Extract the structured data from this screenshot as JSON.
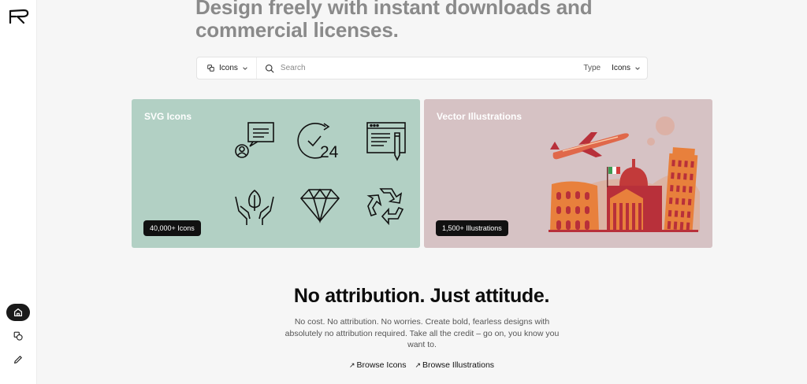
{
  "hero": {
    "title_line1": "Design freely with instant downloads and",
    "title_line2": "commercial licenses."
  },
  "search": {
    "category_label": "Icons",
    "placeholder": "Search",
    "type_label": "Type",
    "type_value": "Icons"
  },
  "cards": {
    "icons": {
      "title": "SVG Icons",
      "badge": "40,000+ Icons",
      "bg": "#b2d0c4"
    },
    "illustrations": {
      "title": "Vector Illustrations",
      "badge": "1,500+ Illustrations",
      "bg": "#d6c2c4"
    }
  },
  "section": {
    "tagline": "No attribution. Just attitude.",
    "body": "No cost. No attribution. No worries. Create bold, fearless designs with absolutely no attribution required. Take all the credit – go on, you know you want to.",
    "link_icons": "Browse Icons",
    "link_illustrations": "Browse Illustrations"
  },
  "sidebar": {
    "items": [
      "home-icon",
      "shapes-icon",
      "pencil-icon"
    ]
  },
  "colors": {
    "accent_dark": "#1a1a1a",
    "illustration_orange": "#e8803c",
    "illustration_red": "#b8303a"
  }
}
